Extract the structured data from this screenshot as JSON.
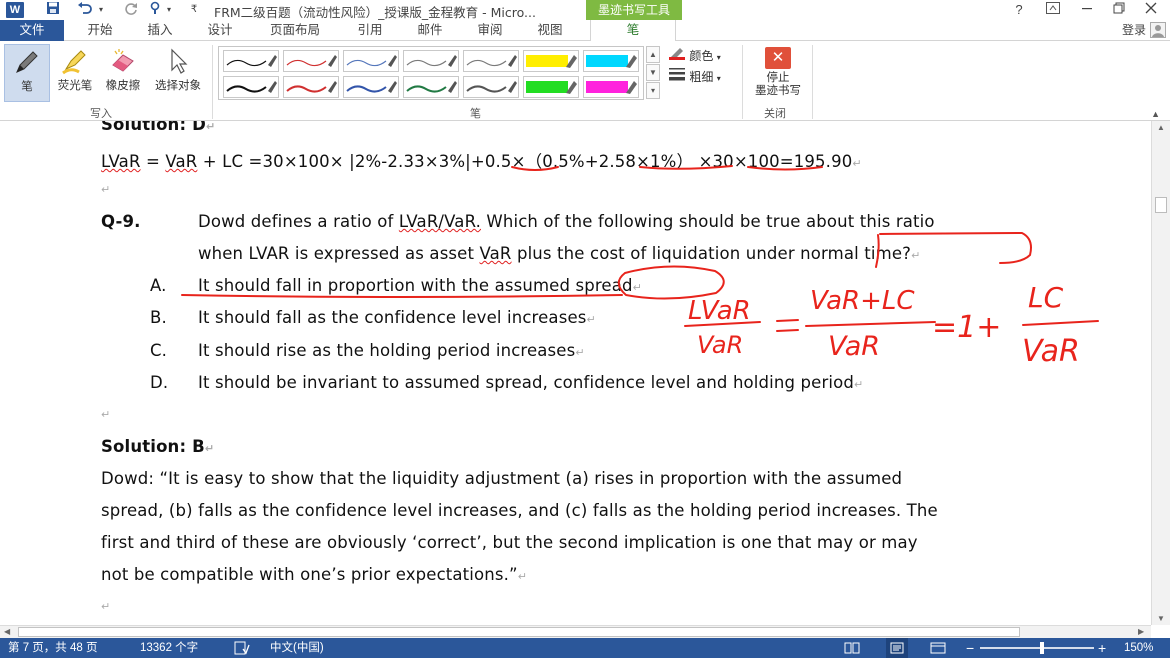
{
  "titlebar": {
    "app_icon": "W",
    "document_title": "FRM二级百题（流动性风险）_授课版_金程教育 - Micro...",
    "context_tab_header": "墨迹书写工具",
    "help": "?",
    "quick_access_icons": [
      "save-icon",
      "undo-icon",
      "redo-icon",
      "customize-icon"
    ]
  },
  "tabs": {
    "file": "文件",
    "items": [
      "开始",
      "插入",
      "设计",
      "页面布局",
      "引用",
      "邮件",
      "审阅",
      "视图"
    ],
    "active": "笔",
    "login": "登录"
  },
  "ribbon": {
    "tools": {
      "pen": "笔",
      "highlighter": "荧光笔",
      "eraser": "橡皮擦",
      "select": "选择对象"
    },
    "group_write_label": "写入",
    "group_pens_label": "笔",
    "group_close_label": "关闭",
    "color_label": "颜色",
    "thickness_label": "粗细",
    "stop_ink_line1": "停止",
    "stop_ink_line2": "墨迹书写",
    "pen_swatch_colors": [
      "#111111",
      "#d03030",
      "#5577bb",
      "#7a7a7a",
      "#7a7a7a",
      "#ffee00",
      "#00d8ff",
      "#111111",
      "#d03030",
      "#3355aa",
      "#227a44",
      "#555555",
      "#22dd22",
      "#ff22dd"
    ]
  },
  "document": {
    "solution_prev": "Solution: D",
    "lvar_formula_parts": {
      "lvar": "LVaR",
      "eq1": " = ",
      "var": "VaR",
      "rest1": " + LC =30×100× |2%-2.33×3%|",
      "plus05": "+0.5×",
      "paren": "（0.5%",
      "part258": "+2.58×1%）",
      "gap": " ",
      "tail": "×30×100=195.90"
    },
    "question_number": "Q-9.",
    "question_line1_a": "Dowd defines a ratio of ",
    "question_line1_b": "LVaR/VaR.",
    "question_line1_c": " Which of the following should be true about this ratio",
    "question_line2_a": "when LVAR is expressed as asset ",
    "question_line2_b": "VaR",
    "question_line2_c": " plus the cost of liquidation under normal time?",
    "options": [
      {
        "letter": "A.",
        "text": "It should fall in proportion with the assumed spread"
      },
      {
        "letter": "B.",
        "text": "It should fall as the confidence level increases"
      },
      {
        "letter": "C.",
        "text": "It should rise as the holding period increases"
      },
      {
        "letter": "D.",
        "text": "It should be invariant to assumed spread, confidence level and holding period"
      }
    ],
    "solution_label": "Solution: B",
    "explanation": [
      "Dowd: “It is easy to show that the liquidity adjustment (a) rises in proportion with the assumed",
      "spread, (b) falls as the confidence level increases, and (c) falls as the holding period increases. The",
      "first and third of these are obviously ‘correct’, but the second implication is one that may or may",
      "not be compatible with one’s prior expectations.”"
    ],
    "para_mark": "↵",
    "handwriting": {
      "lvar": "LVaR",
      "var": "VaR",
      "var_lc": "VaR+LC",
      "eq": "=",
      "one_plus": "=1+",
      "lc": "LC",
      "ink_color": "#e8241c"
    }
  },
  "statusbar": {
    "page": "第 7 页，共 48 页",
    "words": "13362 个字",
    "language": "中文(中国)",
    "zoom": "150%",
    "zoom_minus": "−",
    "zoom_plus": "+"
  }
}
